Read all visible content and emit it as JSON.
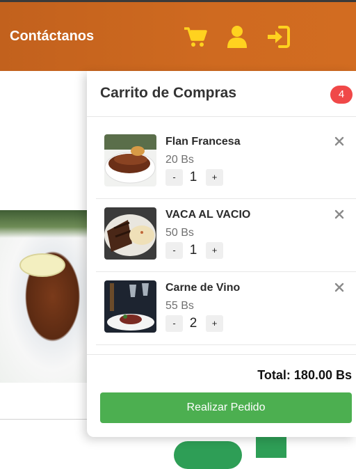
{
  "header": {
    "brand": "Contáctanos",
    "icons": [
      "cart-icon",
      "user-icon",
      "sign-in-icon"
    ],
    "icon_color": "#ffd21f",
    "bg_color": "#cc681f"
  },
  "cart": {
    "title": "Carrito de Compras",
    "badge_count": "4",
    "items": [
      {
        "name": "Flan Francesa",
        "price": "20 Bs",
        "qty": "1",
        "minus": "-",
        "plus": "+"
      },
      {
        "name": "VACA AL VACIO",
        "price": "50 Bs",
        "qty": "1",
        "minus": "-",
        "plus": "+"
      },
      {
        "name": "Carne de Vino",
        "price": "55 Bs",
        "qty": "2",
        "minus": "-",
        "plus": "+"
      }
    ],
    "total": "Total: 180.00 Bs",
    "order_button": "Realizar Pedido",
    "accent": "#4caf50",
    "badge_color": "#f04848"
  }
}
